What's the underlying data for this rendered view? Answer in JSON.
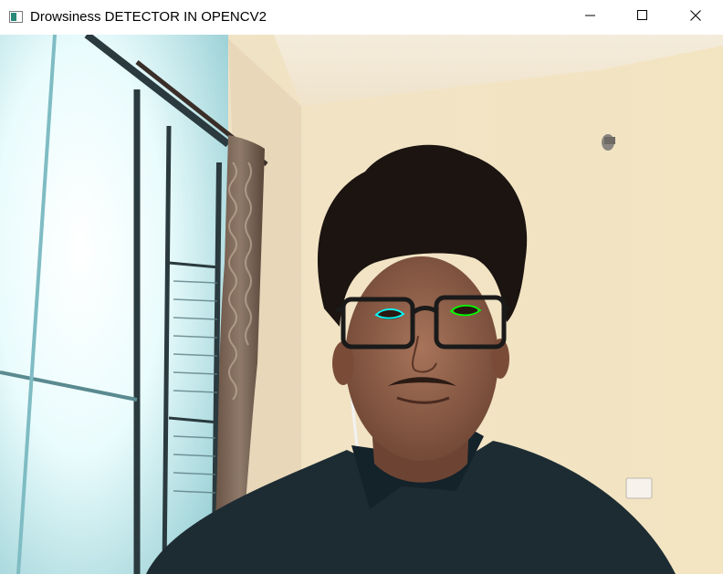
{
  "window": {
    "title": "Drowsiness DETECTOR IN OPENCV2",
    "app_icon": "opencv-window-icon",
    "controls": {
      "minimize": "minimize-icon",
      "maximize": "maximize-icon",
      "close": "close-icon"
    }
  },
  "frame": {
    "content": "webcam-feed",
    "overlays": [
      {
        "name": "left-eye-contour",
        "color": "#00ffff"
      },
      {
        "name": "right-eye-contour",
        "color": "#00ff00"
      }
    ]
  }
}
